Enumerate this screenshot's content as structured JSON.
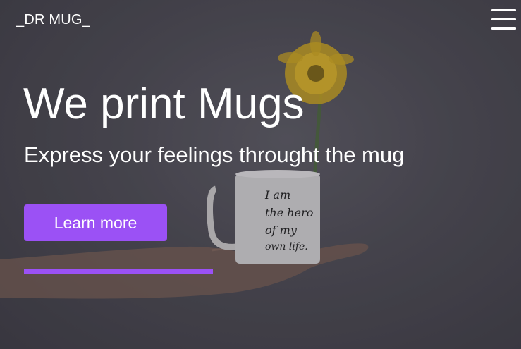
{
  "header": {
    "brand": "_DR MUG_",
    "menu_icon": "hamburger-menu-icon"
  },
  "hero": {
    "title": "We print Mugs",
    "subtitle": "Express your feelings throught the mug",
    "cta_label": "Learn more",
    "mug_text": [
      "I am",
      "the hero",
      "of my",
      "own life."
    ]
  },
  "colors": {
    "accent": "#9b51f5",
    "background": "#4a4850",
    "text": "#ffffff"
  }
}
